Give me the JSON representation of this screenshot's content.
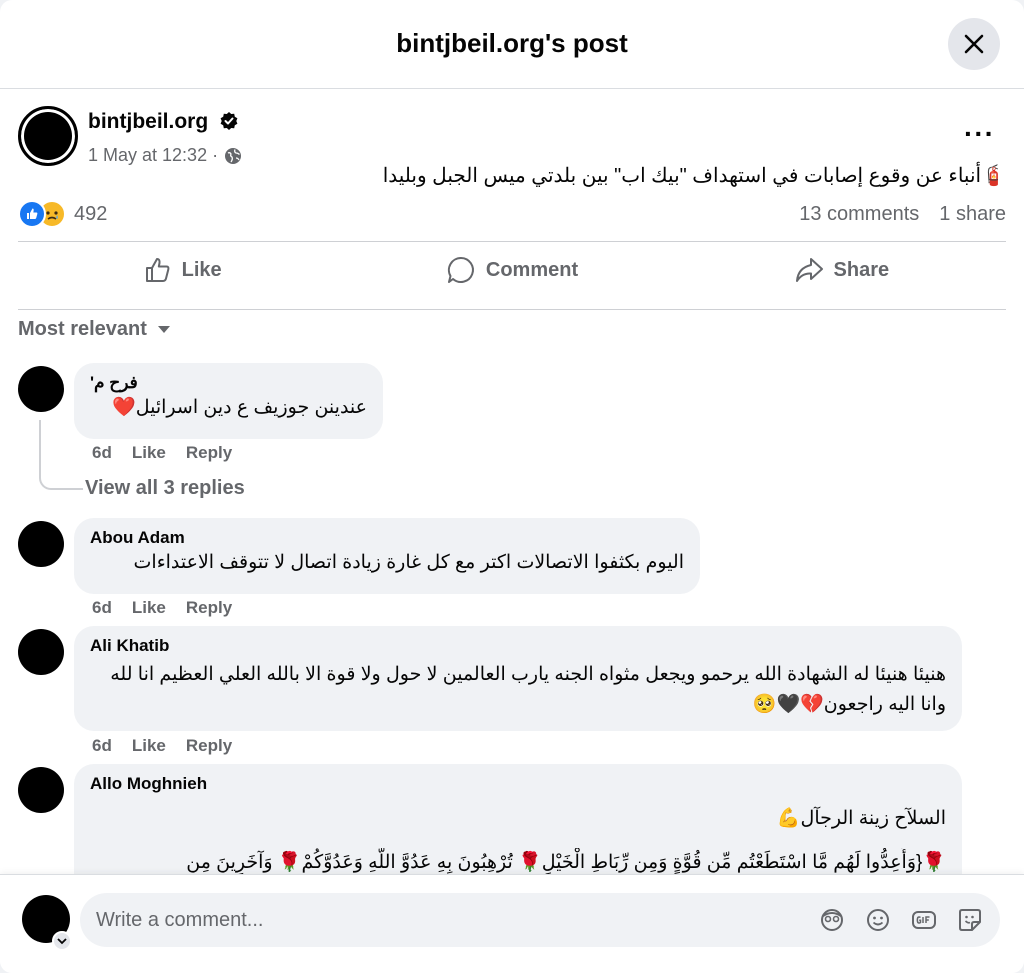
{
  "header": {
    "title": "bintjbeil.org's post"
  },
  "post": {
    "author": "bintjbeil.org",
    "timestamp": "1 May at 12:32 ·",
    "text": "🧯أنباء عن وقوع إصابات في استهداف \"بيك اب\"  بين بلدتي ميس الجبل وبليدا",
    "reaction_count": "492",
    "comments_count": "13 comments",
    "shares_count": "1 share"
  },
  "actions": {
    "like": "Like",
    "comment": "Comment",
    "share": "Share"
  },
  "sort_label": "Most relevant",
  "comments": [
    {
      "name": "فرح م'",
      "text": "عندينن جوزيف ع دين اسرائيل❤️",
      "time": "6d",
      "like": "Like",
      "reply": "Reply",
      "view_replies": "View all 3 replies"
    },
    {
      "name": "Abou Adam",
      "text": "اليوم بكثفوا الاتصالات اكتر مع كل غارة زيادة اتصال لا تتوقف الاعتداءات",
      "time": "6d",
      "like": "Like",
      "reply": "Reply"
    },
    {
      "name": "Ali Khatib",
      "text": "هنيئا هنيئا له الشهادة الله يرحمو ويجعل مثواه الجنه يارب العالمين لا حول ولا قوة الا بالله العلي العظيم انا لله وانا اليه راجعون💔🖤🥺",
      "time": "6d",
      "like": "Like",
      "reply": "Reply"
    },
    {
      "name": "Allo Moghnieh",
      "line1": "السلآح زينة الرجآل💪",
      "line2": "🌹{وَأَعِدُّوا لَهُم مَّا اسْتَطَعْتُم مِّن قُوَّةٍ وَمِن رِّبَاطِ الْخَيْلِ🌹 تُرْهِبُونَ بِهِ عَدُوَّ اللَّهِ وَعَدُوَّكُمْ🌹 وَآخَرِينَ مِن"
    }
  ],
  "composer": {
    "placeholder": "Write a comment..."
  },
  "colors": {
    "like_blue": "#1877f2",
    "text_secondary": "#65676b",
    "bubble": "#f0f2f5"
  }
}
